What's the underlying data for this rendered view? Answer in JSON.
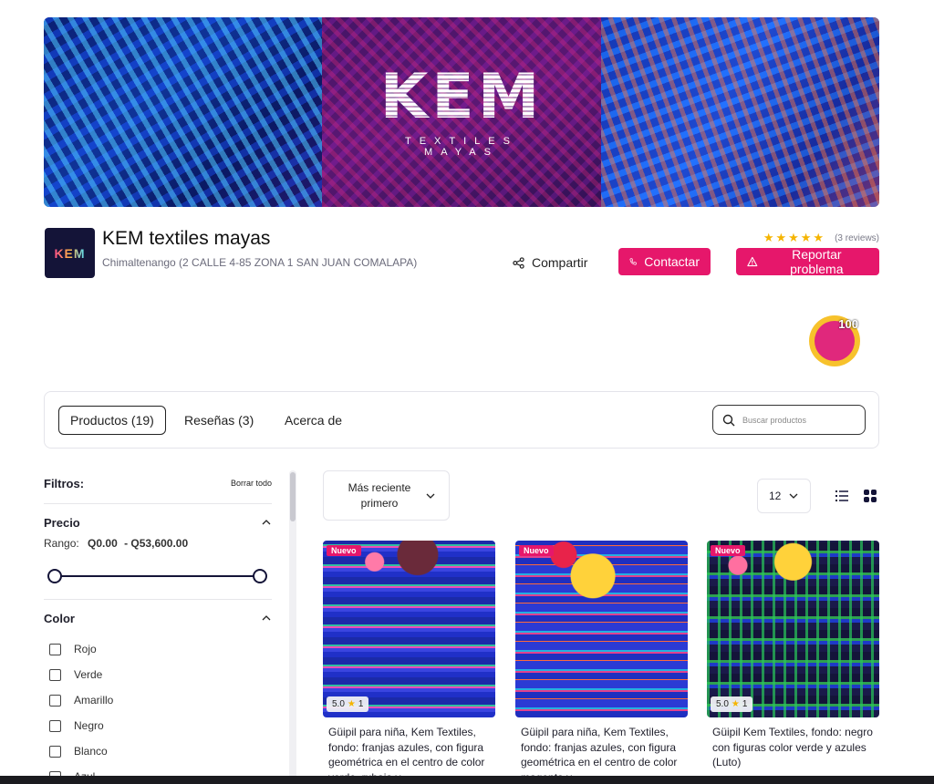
{
  "banner": {
    "logo_text": "KEM",
    "logo_subtitle": "TEXTILES MAYAS"
  },
  "store": {
    "logo_text": "KEM",
    "name": "KEM textiles mayas",
    "address": "Chimaltenango (2 CALLE 4-85 ZONA 1 SAN JUAN COMALAPA)",
    "rating_stars": 5,
    "reviews_count": "(3 reviews)"
  },
  "actions": {
    "share_label": "Compartir",
    "contact_label": "Contactar",
    "report_label": "Reportar problema"
  },
  "badge": {
    "label": "100"
  },
  "tabs": [
    {
      "label": "Productos (19)",
      "active": true
    },
    {
      "label": "Reseñas (3)",
      "active": false
    },
    {
      "label": "Acerca de",
      "active": false
    }
  ],
  "search": {
    "placeholder": "Buscar productos",
    "value": ""
  },
  "filters": {
    "title": "Filtros:",
    "clear_label": "Borrar todo",
    "price": {
      "title": "Precio",
      "range_label": "Rango:",
      "min": "Q0.00",
      "max": "- Q53,600.00"
    },
    "color": {
      "title": "Color",
      "options": [
        "Rojo",
        "Verde",
        "Amarillo",
        "Negro",
        "Blanco",
        "Azul"
      ]
    }
  },
  "toolbar": {
    "sort_label": "Más reciente primero",
    "per_page": "12",
    "view_mode": "grid"
  },
  "products": [
    {
      "badge": "Nuevo",
      "rating": "5.0",
      "rating_count": "1",
      "title": "Güipil para niña, Kem Textiles, fondo: franjas azules, con figura geométrica en el centro de color verde, rubaja y"
    },
    {
      "badge": "Nuevo",
      "rating": "",
      "rating_count": "",
      "title": "Güipil para niña, Kem Textiles, fondo: franjas azules, con figura geométrica en el centro de color magenta y"
    },
    {
      "badge": "Nuevo",
      "rating": "5.0",
      "rating_count": "1",
      "title": "Güipil Kem Textiles, fondo: negro con figuras color verde y azules (Luto)"
    }
  ],
  "colors": {
    "accent": "#e6176b",
    "dark": "#141438",
    "star": "#f5b400"
  }
}
